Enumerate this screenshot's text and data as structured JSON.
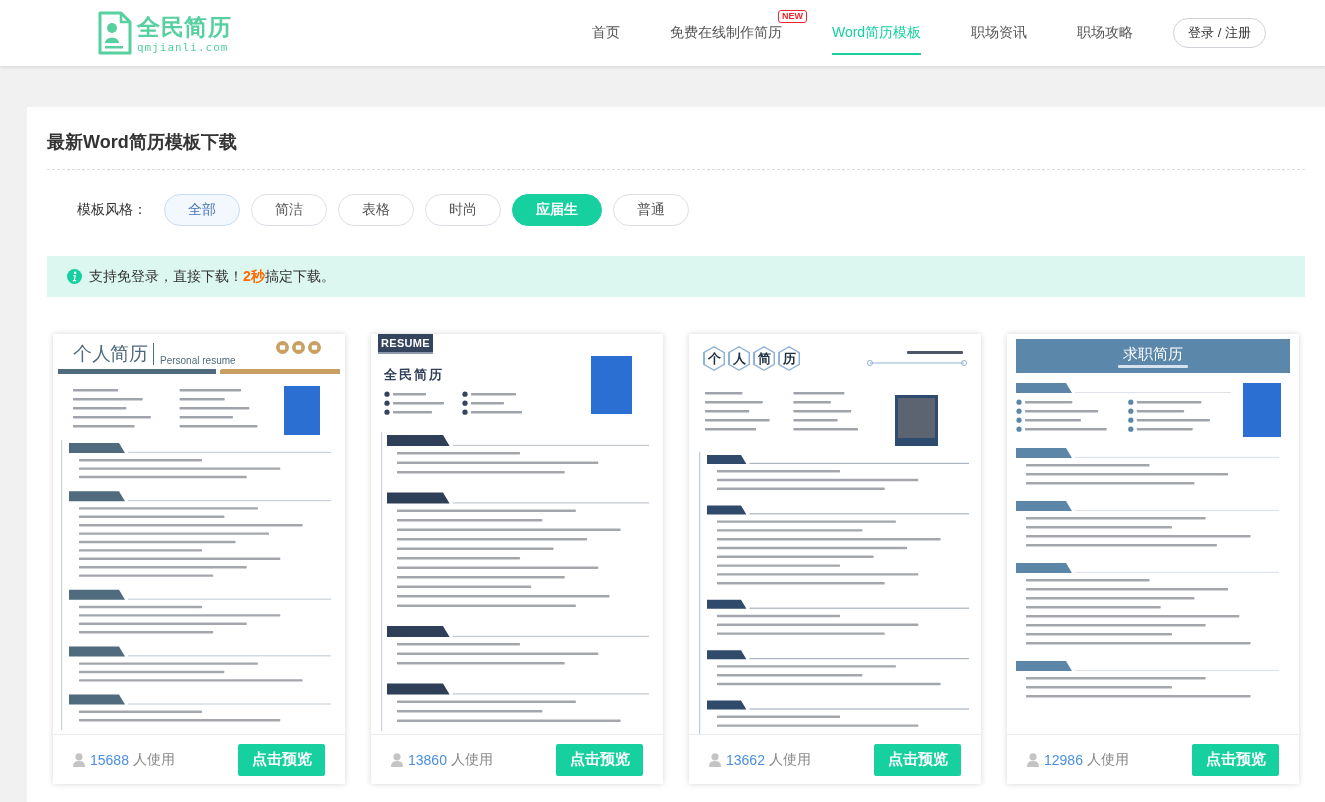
{
  "header": {
    "logo": {
      "name": "全民简历",
      "domain": "qmjianli.com"
    },
    "nav": [
      {
        "label": "首页",
        "selected": false
      },
      {
        "label": "免费在线制作简历",
        "selected": false,
        "badge": "NEW"
      },
      {
        "label": "Word简历模板",
        "selected": true
      },
      {
        "label": "职场资讯",
        "selected": false
      },
      {
        "label": "职场攻略",
        "selected": false
      }
    ],
    "login_button": "登录 / 注册"
  },
  "content": {
    "title": "最新Word简历模板下载",
    "filter": {
      "label": "模板风格：",
      "options": [
        {
          "label": "全部",
          "kind": "all",
          "selected": false
        },
        {
          "label": "简洁",
          "kind": "style",
          "selected": false
        },
        {
          "label": "表格",
          "kind": "style",
          "selected": false
        },
        {
          "label": "时尚",
          "kind": "style",
          "selected": false
        },
        {
          "label": "应届生",
          "kind": "style",
          "selected": true
        },
        {
          "label": "普通",
          "kind": "style",
          "selected": false
        }
      ]
    },
    "notice": "支持免登录，直接下载！**2秒**搞定下载。",
    "templates": [
      {
        "kind": "classic",
        "preview": {
          "title": "个人简历",
          "subtitle": "Personal resume"
        },
        "users": "15688",
        "users_label": "人使用",
        "button": "点击预览"
      },
      {
        "kind": "resume",
        "preview": {
          "label": "RESUME",
          "title": "全民简历"
        },
        "users": "13860",
        "users_label": "人使用",
        "button": "点击预览"
      },
      {
        "kind": "hexagon",
        "preview": {
          "title_tiles": [
            "个",
            "人",
            "简",
            "历"
          ]
        },
        "users": "13662",
        "users_label": "人使用",
        "button": "点击预览"
      },
      {
        "kind": "banner",
        "preview": {
          "title": "求职简历"
        },
        "users": "12986",
        "users_label": "人使用",
        "button": "点击预览"
      }
    ]
  }
}
